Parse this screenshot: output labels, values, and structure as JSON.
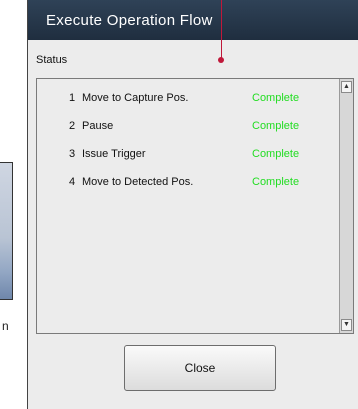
{
  "background": {
    "fragment_text": "n"
  },
  "dialog": {
    "title": "Execute Operation Flow",
    "status_label": "Status",
    "steps": [
      {
        "num": "1",
        "name": "Move to Capture Pos.",
        "state": "Complete"
      },
      {
        "num": "2",
        "name": "Pause",
        "state": "Complete"
      },
      {
        "num": "3",
        "name": "Issue Trigger",
        "state": "Complete"
      },
      {
        "num": "4",
        "name": "Move to Detected Pos.",
        "state": "Complete"
      }
    ],
    "close_label": "Close",
    "scroll_up_glyph": "▲",
    "scroll_down_glyph": "▼"
  },
  "colors": {
    "titlebar": "#2a3b4f",
    "complete": "#22dd22",
    "pointer": "#c0183a"
  }
}
